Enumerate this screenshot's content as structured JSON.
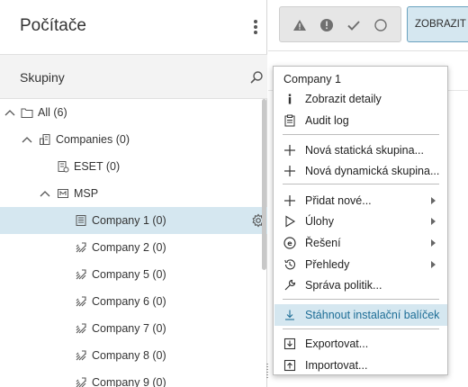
{
  "header": {
    "title": "Počítače"
  },
  "groups": {
    "label": "Skupiny"
  },
  "tree": [
    {
      "label": "All (6)",
      "expanded": true,
      "icon": "folder-icon"
    },
    {
      "label": "Companies (0)",
      "expanded": true,
      "icon": "companies-icon"
    },
    {
      "label": "ESET (0)",
      "icon": "company-icon"
    },
    {
      "label": "MSP",
      "expanded": true,
      "icon": "msp-icon"
    },
    {
      "label": "Company 1 (0)",
      "selected": true,
      "icon": "building-icon"
    },
    {
      "label": "Company 2 (0)",
      "icon": "dynamic-group-icon"
    },
    {
      "label": "Company 5 (0)",
      "icon": "dynamic-group-icon"
    },
    {
      "label": "Company 6 (0)",
      "icon": "dynamic-group-icon"
    },
    {
      "label": "Company 7 (0)",
      "icon": "dynamic-group-icon"
    },
    {
      "label": "Company 8 (0)",
      "icon": "dynamic-group-icon"
    },
    {
      "label": "Company 9 (0)",
      "icon": "dynamic-group-icon"
    }
  ],
  "toolbar": {
    "show_label": "ZOBRAZIT NE"
  },
  "context_menu": {
    "title": "Company 1",
    "items": [
      {
        "label": "Zobrazit detaily",
        "icon": "info-icon"
      },
      {
        "label": "Audit log",
        "icon": "clipboard-icon"
      },
      {
        "label": "Nová statická skupina...",
        "icon": "plus-icon"
      },
      {
        "label": "Nová dynamická skupina...",
        "icon": "plus-icon"
      },
      {
        "label": "Přidat nové...",
        "icon": "plus-icon",
        "submenu": true
      },
      {
        "label": "Úlohy",
        "icon": "play-icon",
        "submenu": true
      },
      {
        "label": "Řešení",
        "icon": "eset-solutions-icon",
        "submenu": true
      },
      {
        "label": "Přehledy",
        "icon": "history-icon",
        "submenu": true
      },
      {
        "label": "Správa politik...",
        "icon": "wrench-icon"
      },
      {
        "label": "Stáhnout instalační balíček",
        "icon": "download-icon",
        "highlighted": true
      },
      {
        "label": "Exportovat...",
        "icon": "export-icon"
      },
      {
        "label": "Importovat...",
        "icon": "import-icon"
      }
    ]
  },
  "colors": {
    "selection": "#d5e7f0",
    "highlight_text": "#1d6d96",
    "accent_border": "#6aa2bf"
  }
}
